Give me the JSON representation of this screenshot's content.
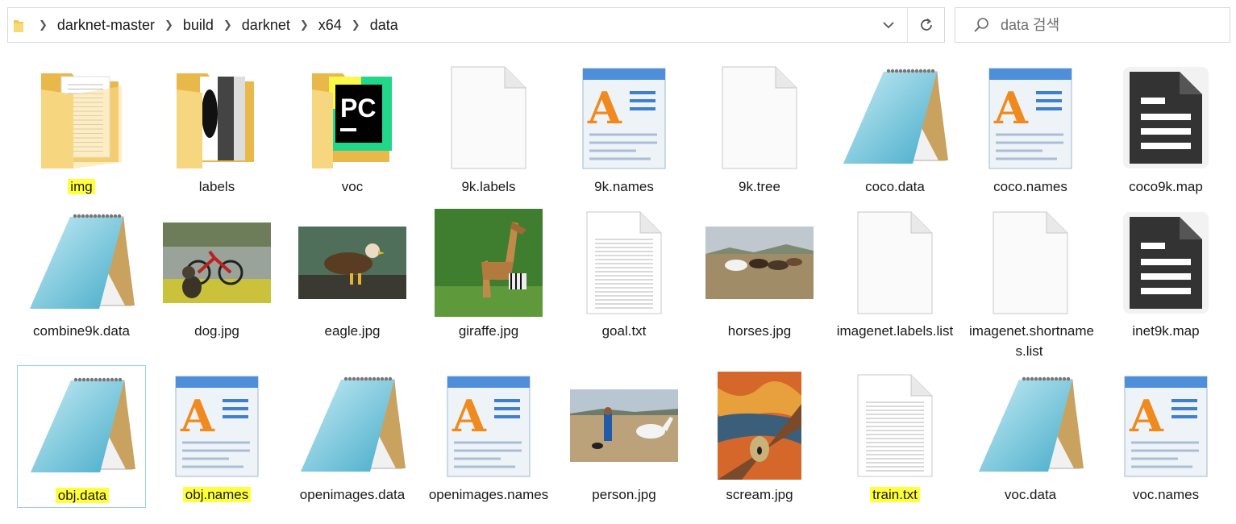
{
  "breadcrumb": [
    "darknet-master",
    "build",
    "darknet",
    "x64",
    "data"
  ],
  "search": {
    "placeholder": "data 검색"
  },
  "files": [
    {
      "name": "img",
      "kind": "folder-doc",
      "highlight": true
    },
    {
      "name": "labels",
      "kind": "folder-bw",
      "highlight": false
    },
    {
      "name": "voc",
      "kind": "folder-pc",
      "highlight": false
    },
    {
      "name": "9k.labels",
      "kind": "blank",
      "highlight": false
    },
    {
      "name": "9k.names",
      "kind": "wordpad",
      "highlight": false
    },
    {
      "name": "9k.tree",
      "kind": "blank",
      "highlight": false
    },
    {
      "name": "coco.data",
      "kind": "notepad",
      "highlight": false
    },
    {
      "name": "coco.names",
      "kind": "wordpad",
      "highlight": false
    },
    {
      "name": "coco9k.map",
      "kind": "doc-dark",
      "highlight": false
    },
    {
      "name": "combine9k.data",
      "kind": "notepad",
      "highlight": false
    },
    {
      "name": "dog.jpg",
      "kind": "photo-dog",
      "highlight": false
    },
    {
      "name": "eagle.jpg",
      "kind": "photo-eagle",
      "highlight": false
    },
    {
      "name": "giraffe.jpg",
      "kind": "photo-giraffe",
      "highlight": false
    },
    {
      "name": "goal.txt",
      "kind": "text",
      "highlight": false
    },
    {
      "name": "horses.jpg",
      "kind": "photo-horses",
      "highlight": false
    },
    {
      "name": "imagenet.labels.list",
      "kind": "blank",
      "highlight": false
    },
    {
      "name": "imagenet.shortnames.list",
      "kind": "blank",
      "highlight": false
    },
    {
      "name": "inet9k.map",
      "kind": "doc-dark",
      "highlight": false
    },
    {
      "name": "obj.data",
      "kind": "notepad",
      "highlight": true,
      "selected": true
    },
    {
      "name": "obj.names",
      "kind": "wordpad",
      "highlight": true
    },
    {
      "name": "openimages.data",
      "kind": "notepad",
      "highlight": false
    },
    {
      "name": "openimages.names",
      "kind": "wordpad",
      "highlight": false
    },
    {
      "name": "person.jpg",
      "kind": "photo-person",
      "highlight": false
    },
    {
      "name": "scream.jpg",
      "kind": "photo-scream",
      "highlight": false
    },
    {
      "name": "train.txt",
      "kind": "text",
      "highlight": true
    },
    {
      "name": "voc.data",
      "kind": "notepad",
      "highlight": false
    },
    {
      "name": "voc.names",
      "kind": "wordpad",
      "highlight": false
    }
  ],
  "colors": {
    "highlight": "#ffff3a",
    "selection_border": "#99d1ea",
    "folder": "#f5d57a"
  }
}
